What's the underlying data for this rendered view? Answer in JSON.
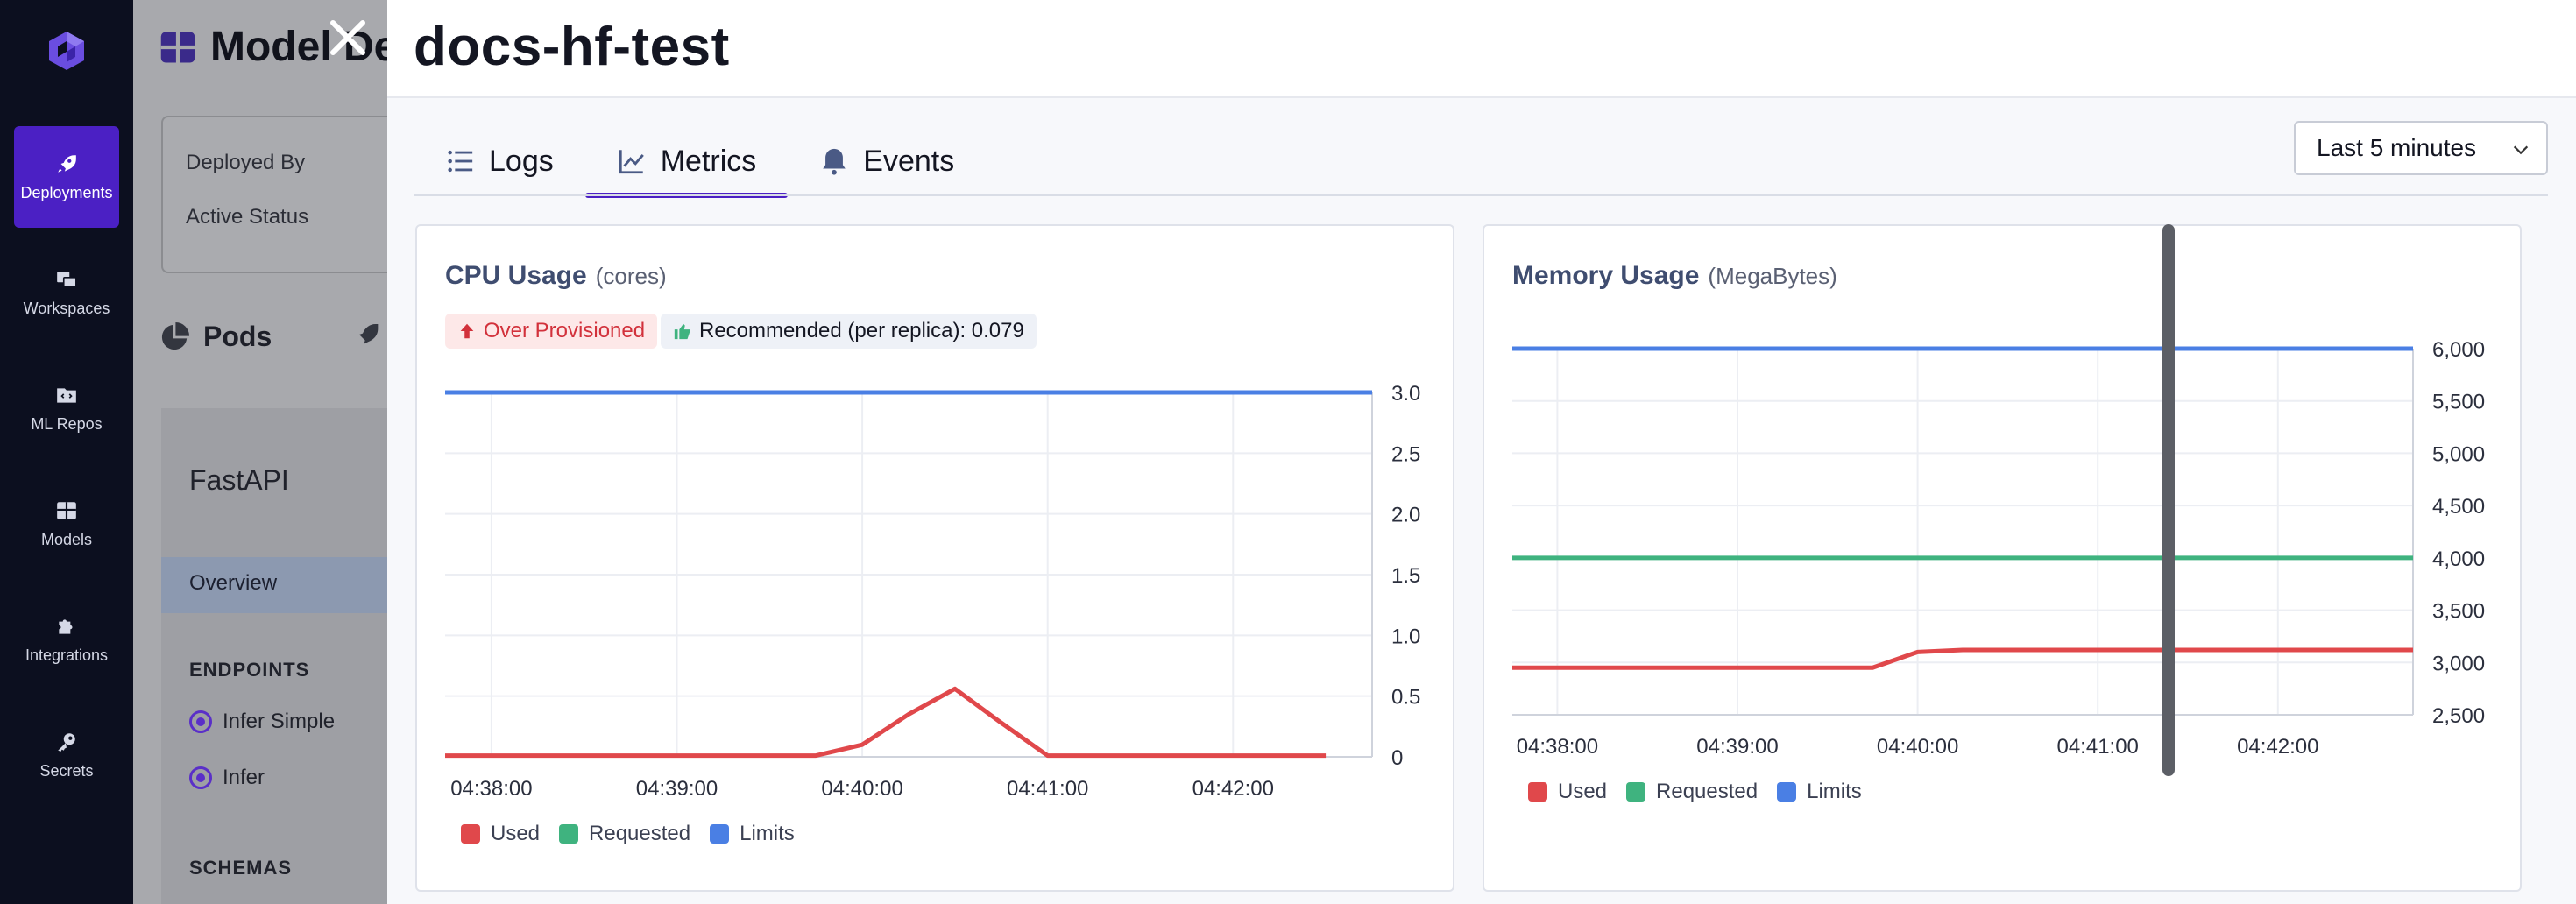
{
  "nav": {
    "items": [
      {
        "label": "Deployments",
        "active": true
      },
      {
        "label": "Workspaces",
        "active": false
      },
      {
        "label": "ML Repos",
        "active": false
      },
      {
        "label": "Models",
        "active": false
      },
      {
        "label": "Integrations",
        "active": false
      },
      {
        "label": "Secrets",
        "active": false
      }
    ]
  },
  "background": {
    "title": "Model De",
    "deployed_by": "Deployed By",
    "active_status": "Active Status",
    "pods": "Pods",
    "service": "FastAPI",
    "overview": "Overview",
    "endpoints_heading": "ENDPOINTS",
    "endpoints": [
      "Infer Simple",
      "Infer"
    ],
    "schemas_heading": "SCHEMAS"
  },
  "drawer": {
    "title": "docs-hf-test",
    "tabs": [
      "Logs",
      "Metrics",
      "Events"
    ],
    "active_tab": "Metrics",
    "time_range": "Last 5 minutes"
  },
  "colors": {
    "used": "#e0484b",
    "requested": "#3fb37f",
    "limits": "#4a7fe4",
    "accent": "#4b20c4"
  },
  "cpu": {
    "title": "CPU Usage",
    "unit": "(cores)",
    "badge_over": "Over Provisioned",
    "badge_recommended": "Recommended (per replica): 0.079",
    "legend": [
      "Used",
      "Requested",
      "Limits"
    ]
  },
  "memory": {
    "title": "Memory Usage",
    "unit": "(MegaBytes)",
    "legend": [
      "Used",
      "Requested",
      "Limits"
    ]
  },
  "chart_data": [
    {
      "type": "line",
      "title": "CPU Usage (cores)",
      "x_ticks": [
        "04:38:00",
        "04:39:00",
        "04:40:00",
        "04:41:00",
        "04:42:00"
      ],
      "y_ticks": [
        "0",
        "0.5",
        "1.0",
        "1.5",
        "2.0",
        "2.5",
        "3.0"
      ],
      "ylim": [
        0,
        3.0
      ],
      "xlim": [
        "04:37:45",
        "04:42:45"
      ],
      "grid": true,
      "legend_position": "bottom-left",
      "series": [
        {
          "name": "Used",
          "color": "#e0484b",
          "x": [
            "04:37:45",
            "04:38:00",
            "04:38:30",
            "04:39:00",
            "04:39:30",
            "04:39:45",
            "04:40:00",
            "04:40:15",
            "04:40:30",
            "04:40:45",
            "04:41:00",
            "04:41:30",
            "04:42:00",
            "04:42:30"
          ],
          "y": [
            0.01,
            0.01,
            0.01,
            0.01,
            0.01,
            0.01,
            0.1,
            0.35,
            0.56,
            0.28,
            0.01,
            0.01,
            0.01,
            0.01
          ]
        },
        {
          "name": "Requested",
          "color": "#3fb37f",
          "x": [
            "04:37:45",
            "04:42:45"
          ],
          "y": [
            3.0,
            3.0
          ]
        },
        {
          "name": "Limits",
          "color": "#4a7fe4",
          "x": [
            "04:37:45",
            "04:42:45"
          ],
          "y": [
            3.0,
            3.0
          ]
        }
      ]
    },
    {
      "type": "line",
      "title": "Memory Usage (MegaBytes)",
      "x_ticks": [
        "04:38:00",
        "04:39:00",
        "04:40:00",
        "04:41:00",
        "04:42:00"
      ],
      "y_ticks": [
        "2,500",
        "3,000",
        "3,500",
        "4,000",
        "4,500",
        "5,000",
        "5,500",
        "6,000"
      ],
      "ylim": [
        2500,
        6000
      ],
      "xlim": [
        "04:37:45",
        "04:42:45"
      ],
      "grid": true,
      "legend_position": "bottom-left",
      "series": [
        {
          "name": "Used",
          "color": "#e0484b",
          "x": [
            "04:37:45",
            "04:38:30",
            "04:39:30",
            "04:39:45",
            "04:40:00",
            "04:40:15",
            "04:41:00",
            "04:42:00",
            "04:42:45"
          ],
          "y": [
            2950,
            2950,
            2950,
            2950,
            3100,
            3120,
            3120,
            3120,
            3120
          ]
        },
        {
          "name": "Requested",
          "color": "#3fb37f",
          "x": [
            "04:37:45",
            "04:42:45"
          ],
          "y": [
            4000,
            4000
          ]
        },
        {
          "name": "Limits",
          "color": "#4a7fe4",
          "x": [
            "04:37:45",
            "04:42:45"
          ],
          "y": [
            6000,
            6000
          ]
        }
      ]
    }
  ]
}
